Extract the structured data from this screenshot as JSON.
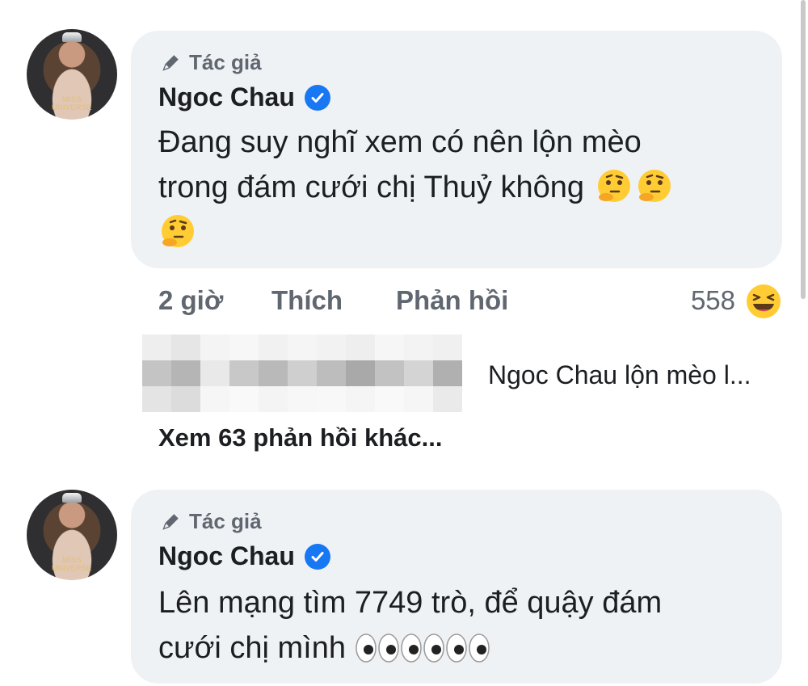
{
  "comments": [
    {
      "badge": "Tác giả",
      "author": "Ngoc Chau",
      "text_line1": "Đang suy nghĩ xem có nên lộn mèo",
      "text_line2": "trong đám cưới chị Thuỷ không",
      "emojis": [
        "thinking-face",
        "thinking-face",
        "thinking-face"
      ]
    },
    {
      "badge": "Tác giả",
      "author": "Ngoc Chau",
      "text_line1": "Lên mạng tìm 7749 trò, để quậy đám",
      "text_line2": "cưới chị mình",
      "emojis": [
        "eyes",
        "eyes",
        "eyes"
      ]
    }
  ],
  "actions": {
    "time": "2 giờ",
    "like": "Thích",
    "reply": "Phản hồi",
    "reaction_count": "558",
    "reaction_icon": "haha-face"
  },
  "reply_preview": {
    "text": "Ngoc Chau lộn mèo l..."
  },
  "more_replies": "Xem 63 phản hồi khác...",
  "avatar_watermark": "MISS UNIVERSE",
  "colors": {
    "bubble": "#eff2f5",
    "secondary_text": "#606770",
    "verified": "#1877f2"
  }
}
